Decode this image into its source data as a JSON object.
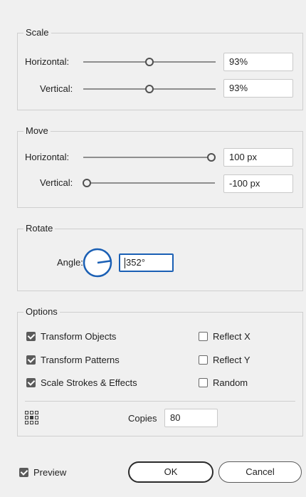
{
  "scale": {
    "legend": "Scale",
    "horizontal": {
      "label": "Horizontal:",
      "value": "93%",
      "level": 0.5
    },
    "vertical": {
      "label": "Vertical:",
      "value": "93%",
      "level": 0.5
    }
  },
  "move": {
    "legend": "Move",
    "horizontal": {
      "label": "Horizontal:",
      "value": "100 px",
      "level": 1.0
    },
    "vertical": {
      "label": "Vertical:",
      "value": "-100 px",
      "level": 0.0
    }
  },
  "rotate": {
    "legend": "Rotate",
    "angle_label": "Angle:",
    "angle_value": "352°",
    "angle_degrees": 352
  },
  "options": {
    "legend": "Options",
    "checkboxes": [
      {
        "label": "Transform Objects",
        "checked": true
      },
      {
        "label": "Transform Patterns",
        "checked": true
      },
      {
        "label": "Scale Strokes & Effects",
        "checked": true
      },
      {
        "label": "Reflect X",
        "checked": false
      },
      {
        "label": "Reflect Y",
        "checked": false
      },
      {
        "label": "Random",
        "checked": false
      }
    ],
    "reference_point_icon": "reference-point-grid-icon",
    "copies_label": "Copies",
    "copies_value": "80"
  },
  "footer": {
    "preview_label": "Preview",
    "preview_checked": true,
    "ok_label": "OK",
    "cancel_label": "Cancel"
  },
  "colors": {
    "accent": "#1a5fb4",
    "background": "#f0f0f0"
  }
}
